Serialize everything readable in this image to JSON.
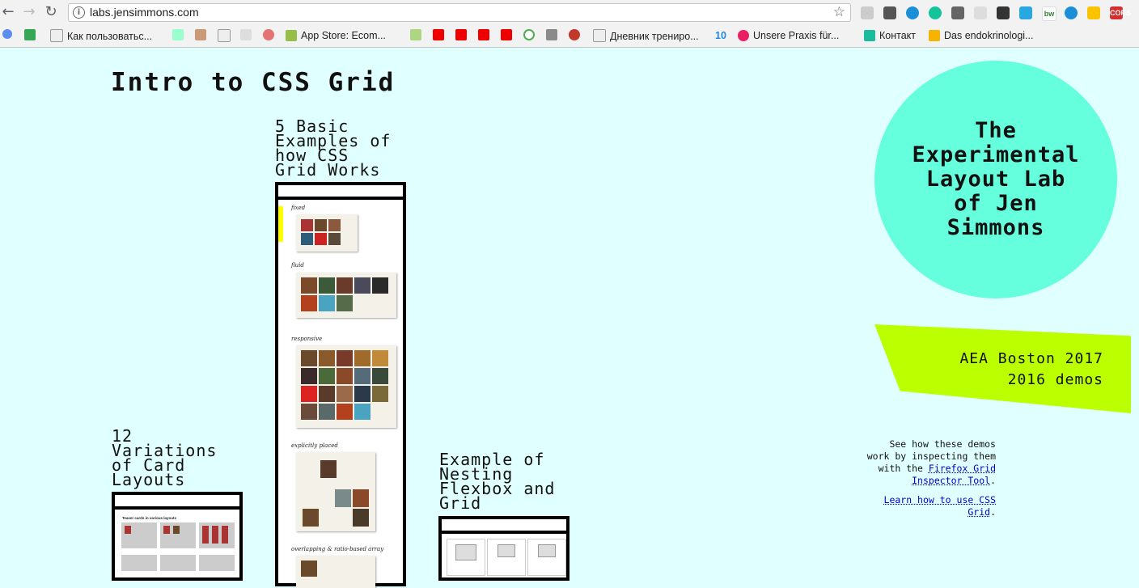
{
  "browser": {
    "url": "labs.jensimmons.com",
    "bookmarks": [
      {
        "label": "Как пользоватьс...",
        "color": "#f5f5f5"
      },
      {
        "label": "App Store: Ecom...",
        "color": "#95bf47"
      },
      {
        "label": "Дневник трениро...",
        "color": "#f5f5f5"
      },
      {
        "label": "Unsere Praxis für...",
        "color": "#e91e63"
      },
      {
        "label": "Контакт",
        "color": "#1abc9c"
      },
      {
        "label": "Das endokrinologi...",
        "color": "#f4b400"
      }
    ],
    "bookmark_number": "10"
  },
  "page": {
    "title": "Intro to CSS Grid",
    "demos": {
      "basic": {
        "heading": "5 Basic\nExamples of\nhow CSS\nGrid Works"
      },
      "cards": {
        "heading": "12\nVariations\nof Card\nLayouts",
        "inner_title": "Teaser cards in various layouts"
      },
      "nesting": {
        "heading": "Example of\nNesting\nFlexbox and\nGrid"
      }
    },
    "thumb_labels": [
      "fixed",
      "fluid",
      "responsive",
      "explicitly placed",
      "overlapping & ratio-based array"
    ],
    "lab_title": "The\nExperimental\nLayout Lab\nof Jen\nSimmons",
    "banner_links": [
      "AEA Boston 2017",
      "2016 demos"
    ],
    "aside": {
      "text1": "See how these demos work by inspecting them with the ",
      "link1": "Firefox Grid Inspector Tool",
      "text1_end": ".",
      "link2": "Learn how to use CSS Grid",
      "text2_end": "."
    }
  }
}
